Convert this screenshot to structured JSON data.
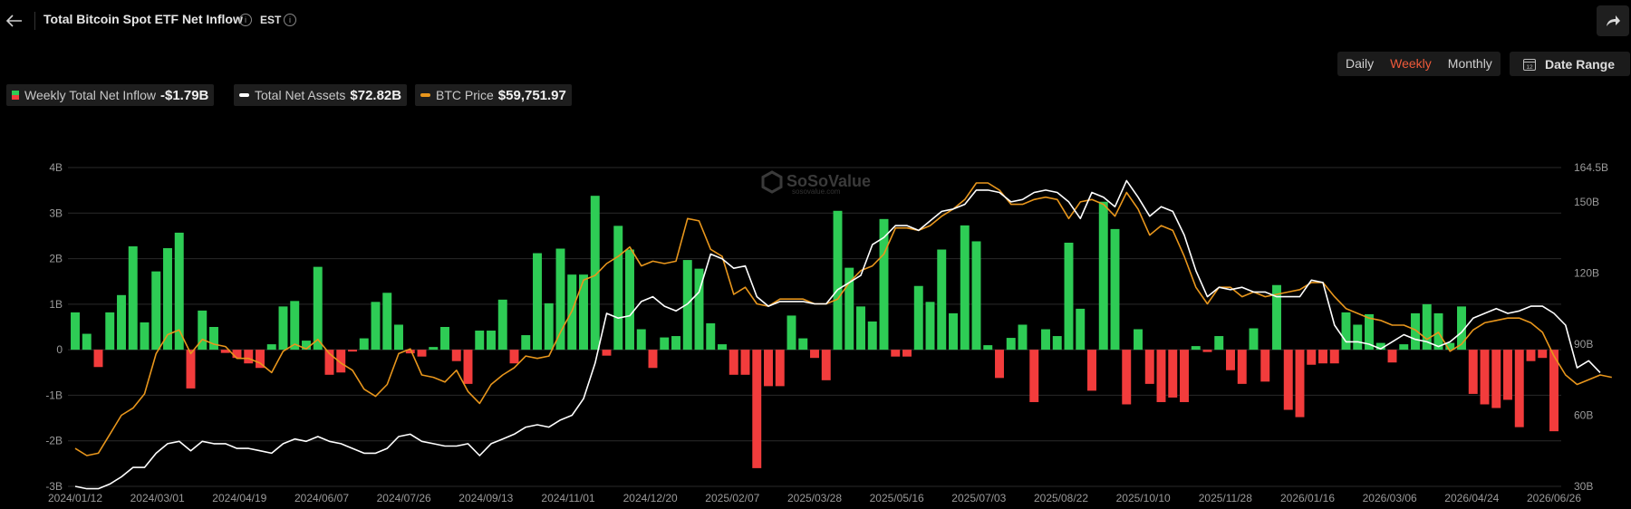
{
  "header": {
    "title": "Total Bitcoin Spot ETF Net Inflow",
    "timezone": "EST"
  },
  "controls": {
    "frequencies": [
      "Daily",
      "Weekly",
      "Monthly"
    ],
    "active_frequency": "Weekly",
    "date_range_label": "Date Range"
  },
  "legend": [
    {
      "label": "Weekly Total Net Inflow",
      "value": "-$1.79B"
    },
    {
      "label": "Total Net Assets",
      "value": "$72.82B"
    },
    {
      "label": "BTC Price",
      "value": "$59,751.97"
    }
  ],
  "colors": {
    "positive": "#2ecc55",
    "negative": "#f23c3c",
    "assets_line": "#ffffff",
    "price_line": "#e8961c",
    "active_tab": "#ef5a3a"
  },
  "watermark": {
    "brand": "SoSoValue",
    "site": "sosovalue.com"
  },
  "chart_data": {
    "type": "bar",
    "x_tick_labels": [
      "2024/01/12",
      "2024/03/01",
      "2024/04/19",
      "2024/06/07",
      "2024/07/26",
      "2024/09/13",
      "2024/11/01",
      "2024/12/20",
      "2025/02/07",
      "2025/03/28",
      "2025/05/16",
      "2025/07/03",
      "2025/08/22",
      "2025/10/10",
      "2025/11/28",
      "2026/01/16",
      "2026/03/06",
      "2026/04/24",
      "2026/06/26"
    ],
    "y_left": {
      "ticks": [
        "4B",
        "3B",
        "2B",
        "1B",
        "0",
        "-1B",
        "-2B",
        "-3B"
      ],
      "range": [
        -3,
        4
      ],
      "unit": "B USD"
    },
    "y_right": {
      "ticks": [
        "164.5B",
        "150B",
        "120B",
        "90B",
        "60B",
        "30B"
      ],
      "range": [
        30,
        164.5
      ]
    },
    "grid": true,
    "series": [
      {
        "name": "Weekly Total Net Inflow",
        "values": [
          0.82,
          0.35,
          -0.38,
          0.82,
          1.2,
          2.27,
          0.6,
          1.72,
          2.23,
          2.57,
          -0.85,
          0.86,
          0.5,
          -0.07,
          -0.18,
          -0.3,
          -0.4,
          0.12,
          0.95,
          1.07,
          0.2,
          1.82,
          -0.55,
          -0.5,
          -0.04,
          0.25,
          1.05,
          1.25,
          0.55,
          -0.08,
          -0.15,
          0.06,
          0.5,
          -0.25,
          -0.75,
          0.42,
          0.42,
          1.1,
          -0.3,
          0.32,
          2.12,
          1.02,
          2.22,
          1.65,
          1.65,
          3.38,
          -0.13,
          2.72,
          2.2,
          0.45,
          -0.4,
          0.27,
          0.3,
          1.97,
          1.78,
          0.58,
          0.12,
          -0.55,
          -0.55,
          -2.6,
          -0.8,
          -0.8,
          0.75,
          0.25,
          -0.18,
          -0.67,
          3.05,
          1.8,
          0.95,
          0.62,
          2.87,
          -0.15,
          -0.15,
          1.4,
          1.05,
          2.2,
          0.8,
          2.73,
          2.38,
          0.1,
          -0.62,
          0.26,
          0.55,
          -1.15,
          0.45,
          0.3,
          2.35,
          0.9,
          -0.9,
          3.25,
          2.65,
          -1.2,
          0.45,
          -0.75,
          -1.15,
          -1.05,
          -1.15,
          0.08,
          -0.05,
          0.3,
          -0.45,
          -0.75,
          0.47,
          -0.7,
          1.42,
          -1.32,
          -1.48,
          -0.33,
          -0.3,
          -0.3,
          0.82,
          0.55,
          0.78,
          0.15,
          -0.28,
          0.12,
          0.8,
          1.0,
          0.8,
          0.15,
          0.95,
          -0.97,
          -1.2,
          -1.28,
          -1.1,
          -1.7,
          -0.25,
          -0.18,
          -1.79
        ]
      },
      {
        "name": "Total Net Assets",
        "values": [
          30,
          29,
          29,
          31,
          34,
          38,
          38,
          44,
          48,
          49,
          45,
          49,
          48,
          48,
          46,
          46,
          45,
          44,
          48,
          50,
          49,
          51,
          49,
          48,
          46,
          44,
          44,
          46,
          51,
          52,
          49,
          48,
          47,
          47,
          48,
          43,
          48,
          50,
          52,
          55,
          56,
          55,
          58,
          60,
          67,
          82,
          103,
          101,
          102,
          108,
          110,
          106,
          104,
          107,
          112,
          128,
          126,
          122,
          123,
          110,
          106,
          108,
          108,
          108,
          107,
          107,
          113,
          116,
          119,
          132,
          135,
          140,
          140,
          138,
          142,
          146,
          147,
          149,
          155,
          155,
          154,
          150,
          151,
          154,
          155,
          154,
          150,
          143,
          154,
          152,
          148,
          159,
          152,
          144,
          148,
          146,
          136,
          121,
          110,
          114,
          113,
          114,
          112,
          112,
          110,
          110,
          110,
          117,
          116,
          98,
          91,
          91,
          90,
          88,
          91,
          94,
          92,
          91,
          89,
          91,
          95,
          101,
          103,
          105,
          103,
          104,
          106,
          106,
          103,
          98,
          80,
          83,
          78
        ]
      },
      {
        "name": "BTC Price",
        "values": [
          46,
          43,
          44,
          52,
          60,
          63,
          69,
          86,
          94,
          96,
          86,
          92,
          90,
          89,
          84,
          84,
          82,
          78,
          87,
          90,
          88,
          92,
          86,
          82,
          79,
          71,
          68,
          73,
          86,
          88,
          77,
          76,
          74,
          79,
          70,
          65,
          73,
          77,
          80,
          85,
          84,
          85,
          95,
          104,
          117,
          119,
          124,
          127,
          131,
          123,
          125,
          124,
          125,
          143,
          142,
          130,
          127,
          111,
          114,
          107,
          106,
          109,
          109,
          109,
          107,
          107,
          109,
          116,
          121,
          123,
          128,
          139,
          139,
          138,
          140,
          144,
          147,
          151,
          158,
          158,
          155,
          149,
          149,
          151,
          152,
          151,
          143,
          150,
          151,
          149,
          144,
          154,
          147,
          136,
          140,
          138,
          127,
          114,
          107,
          114,
          114,
          110,
          112,
          110,
          111,
          112,
          113,
          116,
          116,
          110,
          105,
          103,
          101,
          100,
          98,
          98,
          96,
          92,
          95,
          87,
          90,
          96,
          99,
          100,
          101,
          101,
          99,
          95,
          85,
          77,
          73,
          75,
          77,
          76
        ]
      }
    ]
  }
}
